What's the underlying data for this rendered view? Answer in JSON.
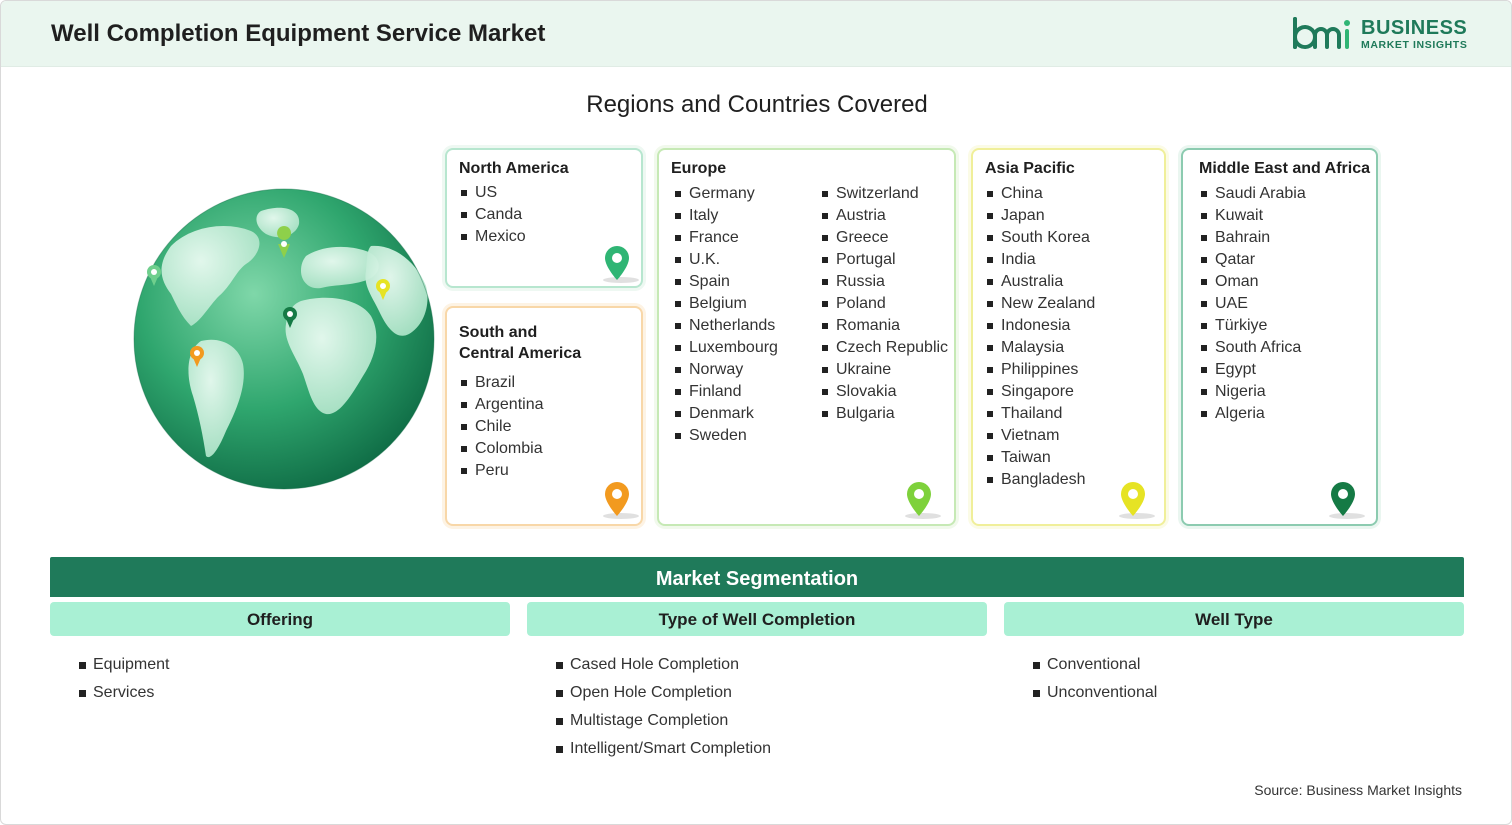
{
  "header": {
    "title": "Well Completion Equipment Service Market",
    "logo_line1": "BUSINESS",
    "logo_line2": "MARKET INSIGHTS"
  },
  "regions_title": "Regions and Countries Covered",
  "regions": {
    "north_america": {
      "name": "North America",
      "countries": [
        "US",
        "Canda",
        "Mexico"
      ],
      "pin_color": "#2fb574"
    },
    "south_central_america": {
      "name_line1": "South and",
      "name_line2": "Central America",
      "countries": [
        "Brazil",
        "Argentina",
        "Chile",
        "Colombia",
        "Peru"
      ],
      "pin_color": "#f29a1f"
    },
    "europe": {
      "name": "Europe",
      "countries_col1": [
        "Germany",
        "Italy",
        "France",
        "U.K.",
        "Spain",
        "Belgium",
        "Netherlands",
        "Luxembourg",
        "Norway",
        "Finland",
        "Denmark",
        "Sweden"
      ],
      "countries_col2": [
        "Switzerland",
        "Austria",
        "Greece",
        "Portugal",
        "Russia",
        "Poland",
        "Romania",
        "Czech Republic",
        "Ukraine",
        "Slovakia",
        "Bulgaria"
      ],
      "pin_color": "#7ed13b"
    },
    "asia_pacific": {
      "name": "Asia Pacific",
      "countries": [
        "China",
        "Japan",
        "South Korea",
        "India",
        "Australia",
        "New Zealand",
        "Indonesia",
        "Malaysia",
        "Philippines",
        "Singapore",
        "Thailand",
        "Vietnam",
        "Taiwan",
        "Bangladesh"
      ],
      "pin_color": "#e6e324"
    },
    "middle_east_africa": {
      "name": "Middle East and Africa",
      "countries": [
        "Saudi Arabia",
        "Kuwait",
        "Bahrain",
        "Qatar",
        "Oman",
        "UAE",
        "Türkiye",
        "South Africa",
        "Egypt",
        "Nigeria",
        "Algeria"
      ],
      "pin_color": "#157a45"
    }
  },
  "segmentation": {
    "title": "Market Segmentation",
    "columns": [
      {
        "heading": "Offering",
        "items": [
          "Equipment",
          "Services"
        ]
      },
      {
        "heading": "Type of Well Completion",
        "items": [
          "Cased Hole Completion",
          "Open Hole Completion",
          "Multistage Completion",
          "Intelligent/Smart Completion"
        ]
      },
      {
        "heading": "Well Type",
        "items": [
          "Conventional",
          "Unconventional"
        ]
      }
    ]
  },
  "source": "Source: Business Market Insights",
  "colors": {
    "brand_green": "#1f7a5a",
    "header_bg": "#eaf6ef",
    "segment_header_bg": "#a9f0d4"
  }
}
